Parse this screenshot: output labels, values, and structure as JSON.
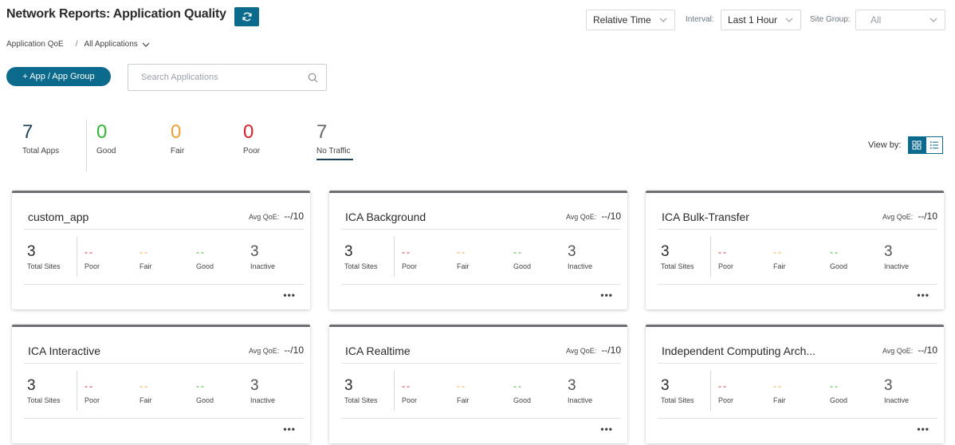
{
  "header": {
    "title": "Network Reports: Application Quality",
    "time_mode": "Relative Time",
    "interval_label": "Interval:",
    "interval_value": "Last 1 Hour",
    "site_group_label": "Site Group:",
    "site_group_value": "All"
  },
  "breadcrumb": {
    "root": "Application QoE",
    "separator": "/",
    "current": "All Applications"
  },
  "toolbar": {
    "add_label": "+ App / App Group",
    "search_placeholder": "Search Applications"
  },
  "summary": {
    "total": {
      "value": "7",
      "label": "Total Apps"
    },
    "good": {
      "value": "0",
      "label": "Good"
    },
    "fair": {
      "value": "0",
      "label": "Fair"
    },
    "poor": {
      "value": "0",
      "label": "Poor"
    },
    "no_traffic": {
      "value": "7",
      "label": "No Traffic"
    }
  },
  "view_by": {
    "label": "View by:",
    "selected": "grid"
  },
  "colors": {
    "accent": "#0c6a8c",
    "good": "#2eb82e",
    "fair": "#f0a030",
    "poor": "#d4222a",
    "total": "#1c3f5a",
    "no_traffic": "#666666"
  },
  "card_labels": {
    "avg_qoe": "Avg QoE:",
    "total_sites": "Total Sites",
    "poor": "Poor",
    "fair": "Fair",
    "good": "Good",
    "inactive": "Inactive",
    "more": "•••"
  },
  "cards": [
    {
      "name": "custom_app",
      "avg_qoe": "--/10",
      "total_sites": "3",
      "poor": "--",
      "fair": "--",
      "good": "--",
      "inactive": "3"
    },
    {
      "name": "ICA Background",
      "avg_qoe": "--/10",
      "total_sites": "3",
      "poor": "--",
      "fair": "--",
      "good": "--",
      "inactive": "3"
    },
    {
      "name": "ICA Bulk-Transfer",
      "avg_qoe": "--/10",
      "total_sites": "3",
      "poor": "--",
      "fair": "--",
      "good": "--",
      "inactive": "3"
    },
    {
      "name": "ICA Interactive",
      "avg_qoe": "--/10",
      "total_sites": "3",
      "poor": "--",
      "fair": "--",
      "good": "--",
      "inactive": "3"
    },
    {
      "name": "ICA Realtime",
      "avg_qoe": "--/10",
      "total_sites": "3",
      "poor": "--",
      "fair": "--",
      "good": "--",
      "inactive": "3"
    },
    {
      "name": "Independent Computing Arch...",
      "avg_qoe": "--/10",
      "total_sites": "3",
      "poor": "--",
      "fair": "--",
      "good": "--",
      "inactive": "3"
    }
  ]
}
